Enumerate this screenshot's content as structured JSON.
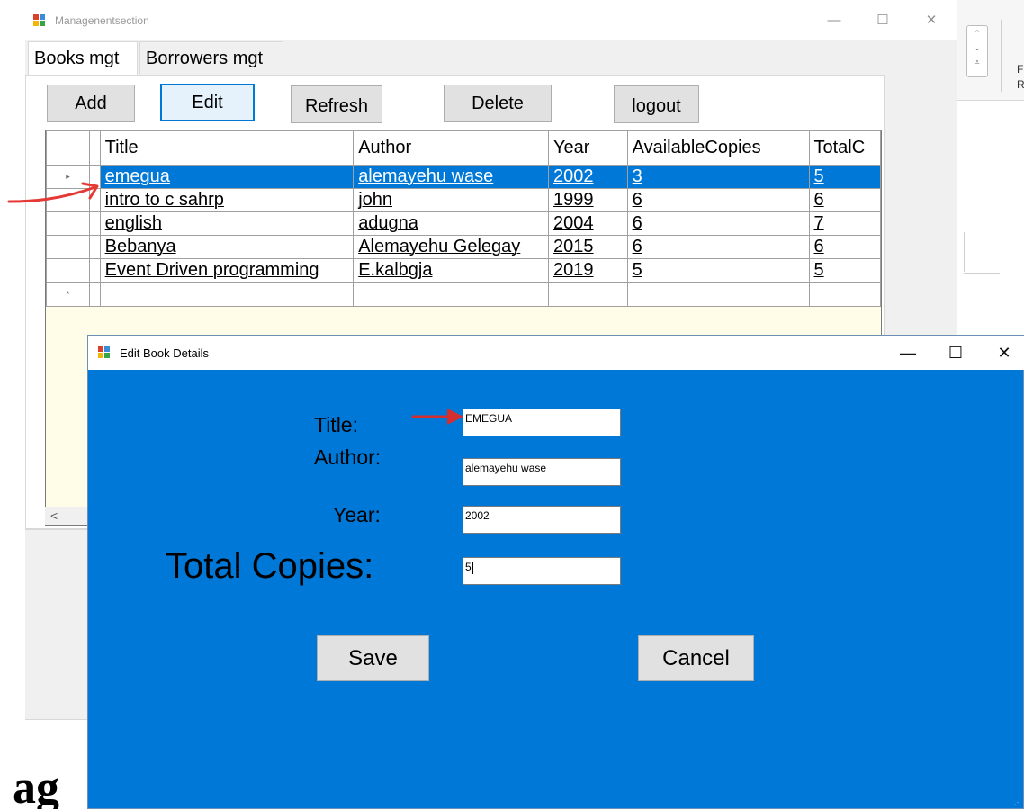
{
  "main_window": {
    "title": "Managenentsection",
    "controls": {
      "minimize": "—",
      "maximize": "☐",
      "close": "✕"
    },
    "tabs": [
      "Books mgt",
      "Borrowers mgt"
    ],
    "toolbar": {
      "add": "Add",
      "edit": "Edit",
      "refresh": "Refresh",
      "delete": "Delete",
      "logout": "logout"
    },
    "grid": {
      "columns": [
        "Title",
        "Author",
        "Year",
        "AvailableCopies",
        "TotalC"
      ],
      "rows": [
        [
          "emegua",
          "alemayehu wase",
          "2002",
          "3",
          "5"
        ],
        [
          "intro to c sahrp",
          "john",
          "1999",
          "6",
          "6"
        ],
        [
          "english",
          "adugna",
          "2004",
          "6",
          "7"
        ],
        [
          "Bebanya",
          "Alemayehu Gelegay",
          "2015",
          "6",
          "6"
        ],
        [
          "Event Driven programming",
          "E.kalbgja",
          "2019",
          "5",
          "5"
        ]
      ],
      "selected_row": 0,
      "current_row_marker": "▸",
      "new_row_marker": "*",
      "scroll_left": "<"
    }
  },
  "dialog": {
    "title": "Edit Book Details",
    "controls": {
      "minimize": "—",
      "maximize": "☐",
      "close": "✕"
    },
    "labels": {
      "title": "Title:",
      "author": "Author:",
      "year": "Year:",
      "total_copies": "Total Copies:"
    },
    "fields": {
      "title": "EMEGUA",
      "author": "alemayehu wase",
      "year": "2002",
      "total_copies": "5"
    },
    "buttons": {
      "save": "Save",
      "cancel": "Cancel"
    }
  },
  "background": {
    "page_text": "ag",
    "ribbon_letters": [
      "F",
      "R"
    ],
    "spinner": {
      "up": "⌃",
      "down": "⌄",
      "more": "⩡"
    }
  },
  "annotations": {
    "arrow_color": "#e53935"
  },
  "colors": {
    "accent": "#0078d7",
    "dialog_bg": "#0078d7",
    "selection": "#0078d7"
  }
}
